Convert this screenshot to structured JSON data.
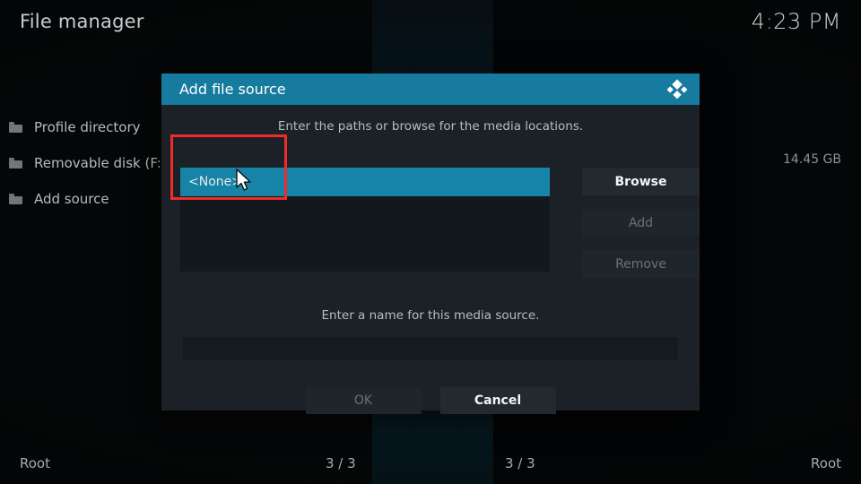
{
  "window": {
    "title": "File manager",
    "clock": "4:23 PM"
  },
  "left_panel": {
    "items": [
      {
        "icon": "folder-icon",
        "label": "Profile directory"
      },
      {
        "icon": "folder-icon",
        "label": "Removable disk (F:)"
      },
      {
        "icon": "folder-icon",
        "label": "Add source"
      }
    ],
    "size_value": "14.45 GB"
  },
  "status_bar": {
    "left": "Root",
    "mid_left": "3 / 3",
    "mid_right": "3 / 3",
    "right": "Root"
  },
  "dialog": {
    "title": "Add file source",
    "logo_icon": "kodi-logo-icon",
    "paths_hint": "Enter the paths or browse for the media locations.",
    "paths": [
      {
        "label": "<None>",
        "selected": true
      }
    ],
    "side_buttons": [
      {
        "label": "Browse",
        "enabled": true
      },
      {
        "label": "Add",
        "enabled": false
      },
      {
        "label": "Remove",
        "enabled": false
      }
    ],
    "name_hint": "Enter a name for this media source.",
    "name_input": {
      "value": "",
      "placeholder": ""
    },
    "footer_buttons": [
      {
        "label": "OK",
        "enabled": false
      },
      {
        "label": "Cancel",
        "enabled": true
      }
    ]
  },
  "annotation": {
    "color": "#ef2b2b"
  },
  "colors": {
    "dialog_header": "#167b9e",
    "selection": "#1783a6",
    "dialog_bg": "#1b2126",
    "list_bg": "#12181c"
  }
}
